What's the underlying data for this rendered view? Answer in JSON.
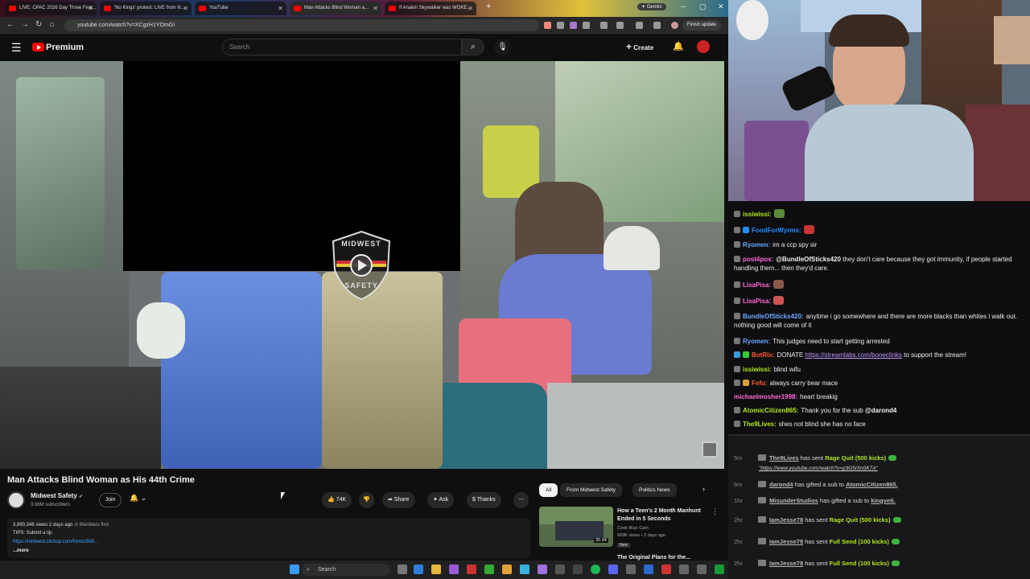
{
  "browser": {
    "tabs": [
      {
        "label": "LIVE: CPAC 2026 Day Three Feat...",
        "active": false
      },
      {
        "label": "'No Kings' protest: LIVE from N...",
        "active": false
      },
      {
        "label": "YouTube",
        "active": false
      },
      {
        "label": "Man Attacks Blind Woman a...",
        "active": true
      },
      {
        "label": "If Anakin Skywalker was WOKE...",
        "active": false
      }
    ],
    "gemini_label": "Gemini",
    "url": "youtube.com/watch?v=XCgzH1YOmGI",
    "finish_update_label": "Finish update"
  },
  "youtube": {
    "brand": "Premium",
    "search_placeholder": "Search",
    "create_label": "Create",
    "video": {
      "title": "Man Attacks Blind Woman as His 44th Crime",
      "watermark_top": "MIDWEST",
      "watermark_bottom": "SAFETY"
    },
    "channel": {
      "name": "Midwest Safety",
      "subscribers": "3.66M subscribers",
      "join_label": "Join"
    },
    "actions": {
      "likes": "74K",
      "share": "Share",
      "ask": "Ask",
      "thanks": "Thanks"
    },
    "description": {
      "stats": "3,990,346 views  2 days ago",
      "members_first": "Members first",
      "tips": "TIPS: Submit a tip:",
      "link": "https://midwest.clickup.com/forms/900...",
      "more": "...more"
    },
    "chips": [
      "All",
      "From Midwest Safety",
      "Politics News"
    ],
    "recommended": [
      {
        "title": "How a Teen's 2 Month Manhunt Ended in 5 Seconds",
        "channel": "Code Blue Cam",
        "views": "669K views • 2 days ago",
        "badge": "New",
        "duration": "35:34"
      },
      {
        "title": "The Original Plans for the..."
      }
    ]
  },
  "taskbar": {
    "search_placeholder": "Search"
  },
  "chat": {
    "messages": [
      {
        "user": "issiwissi:",
        "text": "",
        "color": "#9acd32"
      },
      {
        "user": "FoodForWyrms:",
        "text": "",
        "color": "#1e90ff"
      },
      {
        "user": "Ryomen:",
        "text": "im a ccp spy sir",
        "color": "#1e90ff"
      },
      {
        "user": "post4pox:",
        "mention": "@BundleOfSticks420",
        "text": " they don't care because they got immunity, if people started handling them... then they'd care.",
        "color": "#ff69b4"
      },
      {
        "user": "LisaPisa:",
        "text": "",
        "color": "#ff69b4"
      },
      {
        "user": "LisaPisa:",
        "text": "",
        "color": "#ff69b4"
      },
      {
        "user": "BundleOfSticks420:",
        "text": "anytime i go somewhere and there are more blacks than whites i walk out. nothing good will come of it",
        "color": "#1e90ff"
      },
      {
        "user": "Ryomen:",
        "text": "This judges need to start getting arrested",
        "color": "#1e90ff"
      },
      {
        "user": "BotRix:",
        "text": "DONATE ",
        "link": "https://streamlabs.com/boneclinks",
        "after": " to support the stream!",
        "color": "#ff4500"
      },
      {
        "user": "issiwissi:",
        "text": "blind wifu",
        "color": "#9acd32"
      },
      {
        "user": "Fefu:",
        "text": "always carry bear mace",
        "color": "#ff4500"
      },
      {
        "user": "michaelmosher1998:",
        "text": "heart breakig",
        "color": "#ff69b4"
      },
      {
        "user": "AtomicCitizen865:",
        "text": "Thank you for the sub ",
        "mention": "@darond4",
        "color": "#9acd32"
      },
      {
        "user": "The9Lives:",
        "text": "shes not blind she has no face",
        "color": "#9acd32"
      }
    ]
  },
  "events": [
    {
      "time": "5m",
      "user": "The9Lives",
      "text": " has sent ",
      "gift": "Rage Quit (500 kicks)",
      "link": "\"https://www.youtube.com/watch?v=p3G5IXn0K7A\""
    },
    {
      "time": "6m",
      "user": "darond4",
      "text": " has gifted a sub to ",
      "target": "AtomicCitizen865."
    },
    {
      "time": "1hr",
      "user": "MisunderStudios",
      "text": " has gifted a sub to ",
      "target": "kingyeti."
    },
    {
      "time": "2hr",
      "user": "IamJesse78",
      "text": " has sent ",
      "gift": "Rage Quit (500 kicks)"
    },
    {
      "time": "2hr",
      "user": "IamJesse78",
      "text": " has sent ",
      "gift": "Full Send (100 kicks)"
    },
    {
      "time": "2hr",
      "user": "IamJesse78",
      "text": " has sent ",
      "gift": "Full Send (100 kicks)"
    }
  ]
}
